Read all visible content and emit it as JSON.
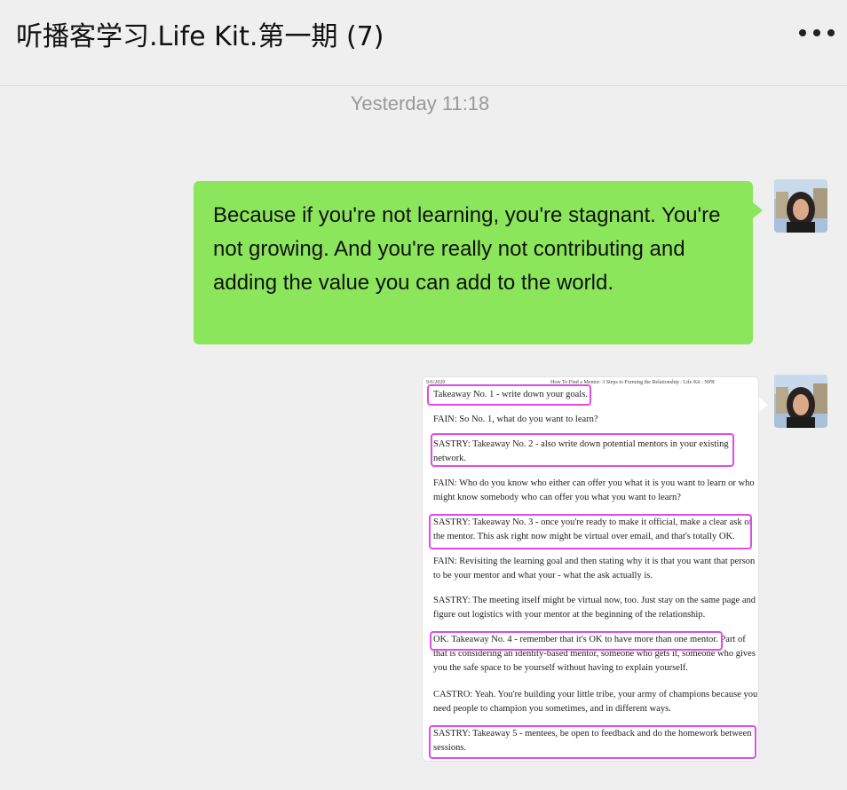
{
  "window": {
    "title": "听播客学习.Life Kit.第一期 (7)",
    "more_icon": "more-horizontal-icon"
  },
  "chat": {
    "timestamp": "Yesterday 11:18",
    "messages": [
      {
        "type": "text",
        "sender": "self",
        "text": "Because if you're not learning, you're stagnant. You're not growing. And you're really not contributing and adding the value you can add to the world.",
        "bubble_color": "#8CE65C"
      },
      {
        "type": "image",
        "sender": "self",
        "document": {
          "header_date": "9/6/2020",
          "header_title": "How To Find a Mentor: 3 Steps to Forming the Relationship : Life Kit : NPR",
          "highlight_color": "#E04CE8",
          "paragraphs": [
            "Takeaway No. 1 - write down your goals.",
            "FAIN: So No. 1, what do you want to learn?",
            "SASTRY: Takeaway No. 2 - also write down potential mentors in your existing network.",
            "FAIN: Who do you know who either can offer you what it is you want to learn or who might know somebody who can offer you what you want to learn?",
            "SASTRY: Takeaway No. 3 - once you're ready to make it official, make a clear ask of the mentor. This ask right now might be virtual over email, and that's totally OK.",
            "FAIN: Revisiting the learning goal and then stating why it is that you want that person to be your mentor and what your - what the ask actually is.",
            "SASTRY: The meeting itself might be virtual now, too. Just stay on the same page and figure out logistics with your mentor at the beginning of the relationship.",
            "OK. Takeaway No. 4 - remember that it's OK to have more than one mentor. Part of that is considering an identity-based mentor, someone who gets it, someone who gives you the safe space to be yourself without having to explain yourself.",
            "CASTRO: Yeah. You're building your little tribe, your army of champions because you need people to champion you sometimes, and in different ways.",
            "SASTRY: Takeaway 5 - mentees, be open to feedback and do the homework between sessions."
          ]
        }
      }
    ]
  }
}
